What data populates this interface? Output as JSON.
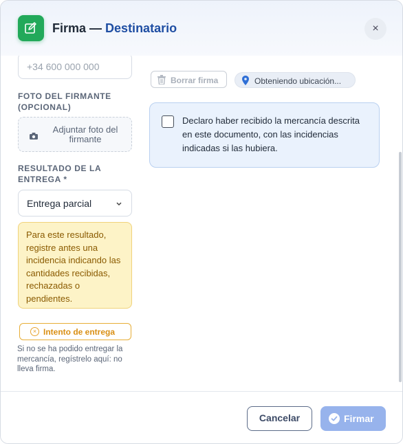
{
  "header": {
    "title": "Firma",
    "separator": " — ",
    "subtitle": "Destinatario",
    "icon": "edit-signature-icon",
    "close_label": "×",
    "accent_color": "#22a95a"
  },
  "phone": {
    "placeholder": "+34 600 000 000"
  },
  "photo": {
    "section_label_line1": "FOTO DEL FIRMANTE",
    "section_label_line2": "(OPCIONAL)",
    "button_line1": "Adjuntar foto del",
    "button_line2": "firmante",
    "icon": "camera-icon"
  },
  "result": {
    "section_label_line1": "RESULTADO DE LA",
    "section_label_line2": "ENTREGA *",
    "selected": "Entrega parcial",
    "chevron": "⌄"
  },
  "warning": {
    "text": "Para este resultado, registre antes una incidencia indicando las cantidades recibidas, rechazadas o pendientes.",
    "color": "#fdf3c7"
  },
  "delivery_attempt": {
    "label": "Intento de entrega",
    "help": "Si no se ha podido entregar la mercancía, regístrelo aquí: no lleva firma.",
    "color": "#e7ad35"
  },
  "signature": {
    "clear_label": "Borrar firma",
    "location_label": "Obteniendo ubicación..."
  },
  "declaration": {
    "checked": false,
    "text": "Declaro haber recibido la mercancía descrita en este documento, con las incidencias indicadas si las hubiera."
  },
  "footer": {
    "cancel_label": "Cancelar",
    "sign_label": "Firmar",
    "sign_color": "#97b3ec"
  }
}
